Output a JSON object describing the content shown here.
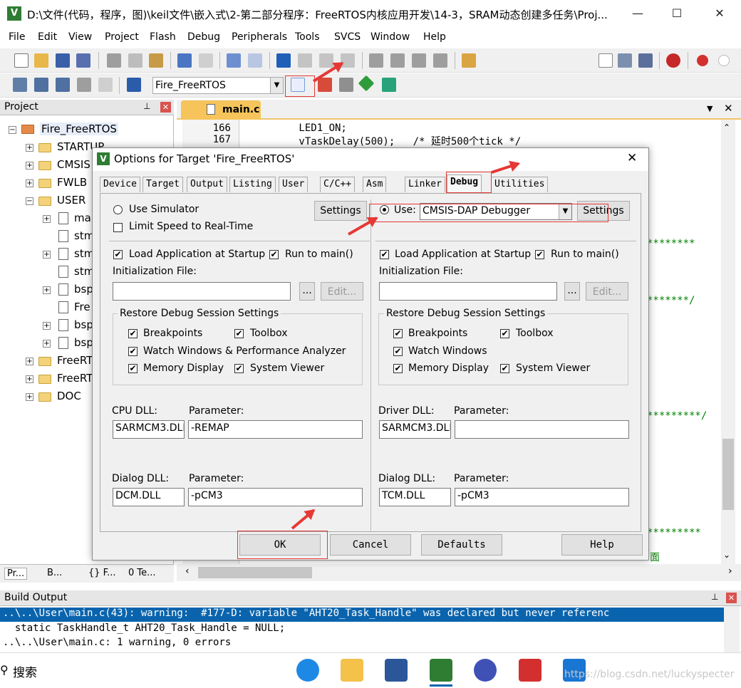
{
  "window": {
    "title": "D:\\文件(代码，程序，图)\\keil文件\\嵌入式\\2-第二部分程序：FreeRTOS内核应用开发\\14-3，SRAM动态创建多任务\\Proj..."
  },
  "menu": [
    "File",
    "Edit",
    "View",
    "Project",
    "Flash",
    "Debug",
    "Peripherals",
    "Tools",
    "SVCS",
    "Window",
    "Help"
  ],
  "toolbar": {
    "target": "Fire_FreeRTOS"
  },
  "project": {
    "header": "Project",
    "root": "Fire_FreeRTOS",
    "items": [
      "STARTUP",
      "CMSIS",
      "FWLB",
      "USER",
      "mai",
      "stm",
      "stm",
      "stm",
      "bsp",
      "Fre",
      "bsp",
      "bsp",
      "FreeRT",
      "FreeRT",
      "DOC"
    ],
    "bottom_tabs": [
      "Pr...",
      "B...",
      "{} F...",
      "0 Te..."
    ]
  },
  "editor": {
    "tab": "main.c",
    "lines": [
      {
        "num": "166",
        "code": "        LED1_ON;"
      },
      {
        "num": "167",
        "code": "        vTaskDelay(500);   /* 延时500个tick */"
      }
    ],
    "fragments": [
      "********",
      "*******/",
      "*********/",
      "*********",
      "面"
    ]
  },
  "dialog": {
    "title": "Options for Target 'Fire_FreeRTOS'",
    "close": "✕",
    "tabs": [
      "Device",
      "Target",
      "Output",
      "Listing",
      "User",
      "C/C++",
      "Asm",
      "Linker",
      "Debug",
      "Utilities"
    ],
    "left": {
      "use_simulator": "Use Simulator",
      "limit_speed": "Limit Speed to Real-Time",
      "settings": "Settings",
      "load_app": "Load Application at Startup",
      "run_main": "Run to main()",
      "init_file": "Initialization File:",
      "browse": "...",
      "edit": "Edit...",
      "restore": "Restore Debug Session Settings",
      "breakpoints": "Breakpoints",
      "toolbox": "Toolbox",
      "watch": "Watch Windows & Performance Analyzer",
      "memory": "Memory Display",
      "sysviewer": "System Viewer",
      "cpu_dll_label": "CPU DLL:",
      "param_label": "Parameter:",
      "cpu_dll": "SARMCM3.DLL",
      "cpu_param": "-REMAP",
      "dialog_dll_label": "Dialog DLL:",
      "dialog_dll": "DCM.DLL",
      "dialog_param": "-pCM3"
    },
    "right": {
      "use": "Use:",
      "debugger": "CMSIS-DAP Debugger",
      "settings": "Settings",
      "load_app": "Load Application at Startup",
      "run_main": "Run to main()",
      "init_file": "Initialization File:",
      "browse": "...",
      "edit": "Edit...",
      "restore": "Restore Debug Session Settings",
      "breakpoints": "Breakpoints",
      "toolbox": "Toolbox",
      "watch": "Watch Windows",
      "memory": "Memory Display",
      "sysviewer": "System Viewer",
      "driver_dll_label": "Driver DLL:",
      "param_label": "Parameter:",
      "driver_dll": "SARMCM3.DLL",
      "driver_param": "",
      "dialog_dll_label": "Dialog DLL:",
      "dialog_dll": "TCM.DLL",
      "dialog_param": "-pCM3"
    },
    "buttons": {
      "ok": "OK",
      "cancel": "Cancel",
      "defaults": "Defaults",
      "help": "Help"
    }
  },
  "build": {
    "header": "Build Output",
    "lines": [
      "..\\..\\User\\main.c(43): warning:  #177-D: variable \"AHT20_Task_Handle\" was declared but never referenc",
      "  static TaskHandle_t AHT20_Task_Handle = NULL;",
      "..\\..\\User\\main.c: 1 warning, 0 errors"
    ]
  },
  "taskbar": {
    "search": "搜索",
    "watermark": "https://blog.csdn.net/luckyspecter"
  },
  "colors": {
    "accent": "#e53935",
    "selection": "#0a64ad",
    "comment": "#008000"
  }
}
